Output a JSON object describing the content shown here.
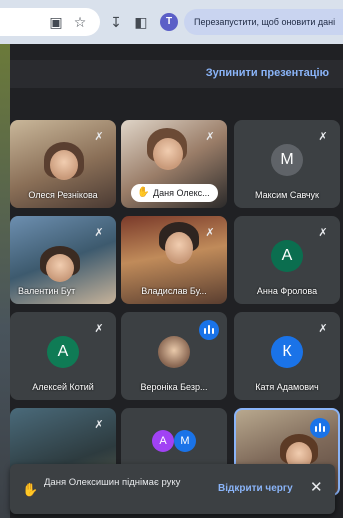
{
  "browser": {
    "restart_message": "Перезапустити, щоб оновити данi",
    "profile_initial": "T",
    "icons": [
      "camera-icon",
      "star-icon",
      "download-icon",
      "sidepanel-icon"
    ]
  },
  "meet": {
    "stop_presentation": "Зупинити презентацію",
    "tiles": [
      {
        "name": "Олеся Резнікова",
        "type": "video",
        "muted": true
      },
      {
        "name": "Даня Олекс...",
        "type": "video",
        "hand_raised": true,
        "muted": true
      },
      {
        "name": "Максим Савчук",
        "type": "avatar",
        "initial": "М",
        "color": "#5f6368",
        "muted": true
      },
      {
        "name": "Валентин Бут",
        "type": "video",
        "muted": true
      },
      {
        "name": "Владислав Бу...",
        "type": "video",
        "muted": true
      },
      {
        "name": "Анна Фролова",
        "type": "avatar",
        "initial": "А",
        "color": "#0b6e4f",
        "muted": true
      },
      {
        "name": "Алексей Котий",
        "type": "avatar",
        "initial": "А",
        "color": "#0f7b55",
        "muted": true
      },
      {
        "name": "Вероніка Безр...",
        "type": "photo",
        "speaking": true
      },
      {
        "name": "Катя Адамович",
        "type": "avatar",
        "initial": "К",
        "color": "#1a73e8",
        "muted": true
      },
      {
        "name": "",
        "type": "video",
        "muted": true
      },
      {
        "name": "",
        "type": "group",
        "initials": [
          "А",
          "М"
        ],
        "colors": [
          "#a142f4",
          "#1a73e8"
        ]
      },
      {
        "name": "",
        "type": "video",
        "speaking": true
      }
    ]
  },
  "toast": {
    "message": "Даня Олексишин піднімає руку",
    "action": "Відкрити чергу",
    "close": "✕"
  }
}
